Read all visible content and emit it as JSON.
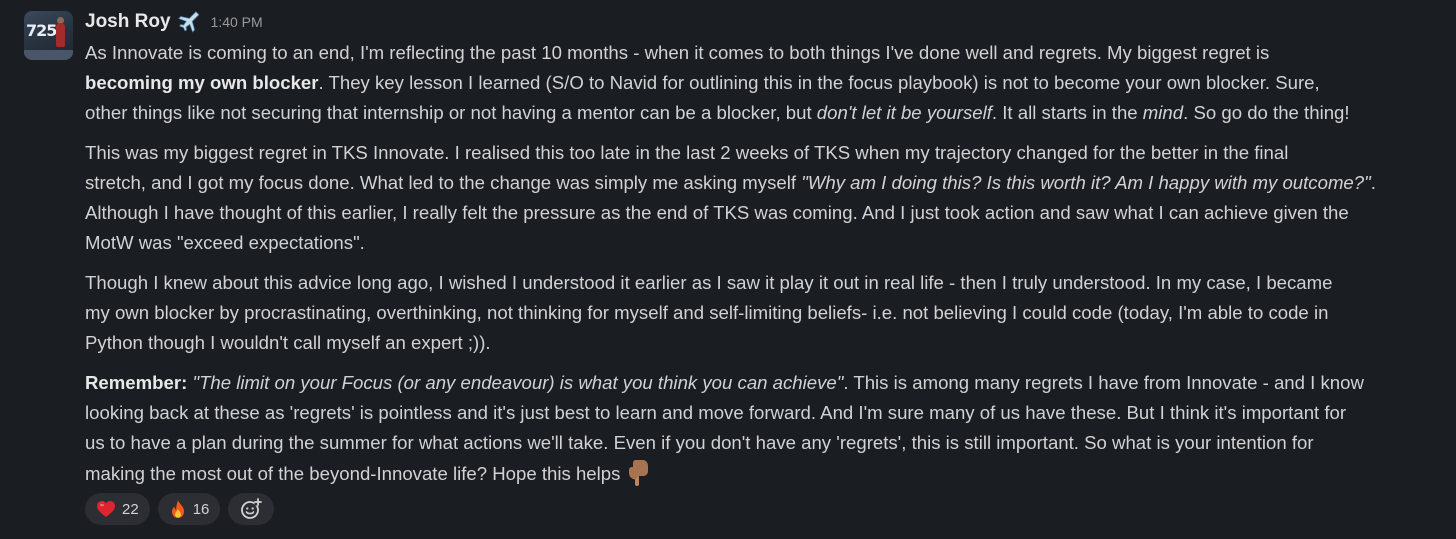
{
  "message": {
    "author": "Josh Roy",
    "author_badge_icon": "airplane-icon",
    "timestamp": "1:40 PM",
    "avatar_text": "725",
    "p1": {
      "l1": "As Innovate is coming to an end, I'm reflecting the past 10 months - when it comes to both things I've done well and regrets. My biggest regret is",
      "l2_bold": "becoming my own blocker",
      "l2_rest": ". They key lesson I learned (S/O to Navid for outlining this in the focus playbook) is not to become your own blocker. Sure,",
      "l3_a": "other things like not securing that internship or not having a mentor can be a blocker, but ",
      "l3_i1": "don't let it be yourself",
      "l3_b": ". It all starts in the ",
      "l3_i2": "mind",
      "l3_c": ". So go do the thing!"
    },
    "p2": {
      "l1": "This was my biggest regret in TKS Innovate. I realised this too late in the last 2 weeks of TKS when my trajectory changed for the better in the final",
      "l2": "stretch, and I got my focus done. What led to the change was simply me asking myself ",
      "l2_i": "\"Why am I doing this? Is this worth it? Am I happy with my outcome?\"",
      "l2_end": ".",
      "l3": "Although I have thought of this earlier, I really felt the pressure as the end of TKS was coming. And I just took action and saw what I can achieve given the",
      "l4": "MotW was \"exceed expectations\"."
    },
    "p3": {
      "l1": "Though I knew about this advice long ago, I wished I understood it earlier as I saw it play it out in real life - then I truly understood. In my case, I became",
      "l2": "my own blocker by procrastinating, overthinking, not thinking for myself and self-limiting beliefs- i.e. not believing I could code (today, I'm able to code in",
      "l3": "Python though I wouldn't call myself an expert ;))."
    },
    "p4": {
      "l1_bold": "Remember:",
      "l1_i": " \"The limit on your Focus (or any endeavour) is what you think you can achieve\"",
      "l1_rest": ". This is among many regrets I have from Innovate - and I know",
      "l2": "looking back at these as 'regrets' is pointless and it's just best to learn and move forward. And I'm sure many of us have these. But I think it's important for",
      "l3": "us to have a plan during the summer for what actions we'll take. Even if you don't have any 'regrets', this is still important. So what is your intention for",
      "l4": "making the most out of the beyond-Innovate life? Hope this helps",
      "l4_emoji": "pointing-down-icon"
    }
  },
  "reactions": [
    {
      "icon": "red-heart-icon",
      "count": "22"
    },
    {
      "icon": "fire-icon",
      "count": "16"
    },
    {
      "icon": "add-reaction-icon"
    }
  ],
  "colors": {
    "background": "#1a1d21",
    "text": "#d1d2d3",
    "author": "#e8e8e8",
    "timestamp": "#9a9b9d",
    "reaction_pill": "#2c2e33"
  }
}
